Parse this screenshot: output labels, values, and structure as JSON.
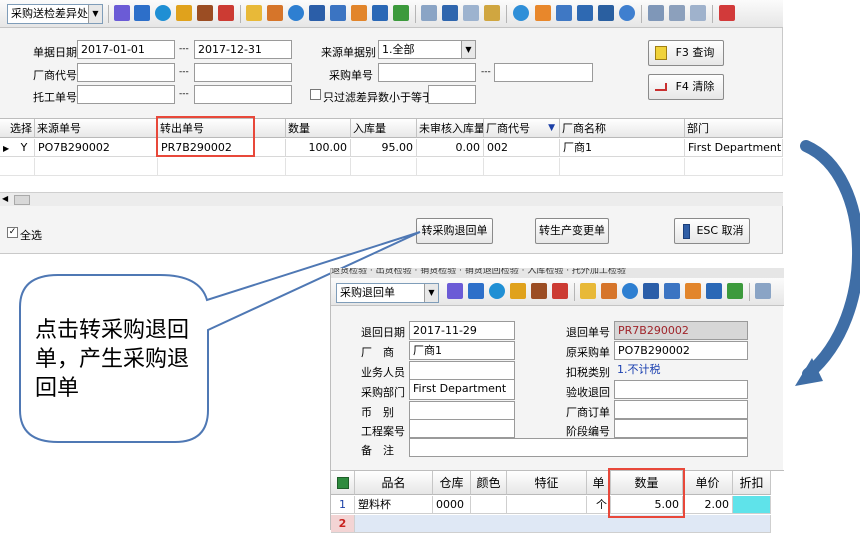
{
  "main_window": {
    "module_select": "采购送检差异处",
    "filters": {
      "doc_date_label": "单据日期",
      "doc_date_from": "2017-01-01",
      "doc_date_to": "2017-12-31",
      "range_sep": "---",
      "vendor_code_label": "厂商代号",
      "outsource_no_label": "托工单号",
      "source_type_label": "来源单据别",
      "source_type_value": "1.全部",
      "purchase_no_label": "采购单号",
      "diff_only_label": "只过滤差异数小于等于"
    },
    "buttons": {
      "query": "F3 查询",
      "clear": "F4 清除"
    },
    "grid": {
      "columns": [
        "选择",
        "来源单号",
        "转出单号",
        "数量",
        "入库量",
        "未审核入库量",
        "厂商代号",
        "厂商名称",
        "部门"
      ],
      "rows": [
        [
          "Y",
          "PO7B290002",
          "PR7B290002",
          "100.00",
          "95.00",
          "0.00",
          "002",
          "厂商1",
          "First Department"
        ]
      ]
    },
    "select_all_label": "全选",
    "actions": {
      "to_purchase_return": "转采购退回单",
      "to_production_change": "转生产变更单",
      "cancel": "ESC 取消"
    }
  },
  "callout": {
    "text": "点击转采购退回单，产生采购退回单"
  },
  "return_window": {
    "tab_strip": "退货检验 · 出货检验 · 销货检验 · 销货退回检验 · 入库检验 · 托外加工检验",
    "module_select": "采购退回单",
    "fields": {
      "return_date_label": "退回日期",
      "return_date": "2017-11-29",
      "vendor_label": "厂　商",
      "vendor": "厂商1",
      "salesperson_label": "业务人员",
      "dept_label": "采购部门",
      "dept": "First Department",
      "currency_label": "币　别",
      "project_no_label": "工程案号",
      "remark_label": "备　注",
      "return_no_label": "退回单号",
      "return_no": "PR7B290002",
      "orig_purchase_label": "原采购单",
      "orig_purchase": "PO7B290002",
      "tax_type_label": "扣税类别",
      "tax_type": "1.不计税",
      "inspection_return_label": "验收退回",
      "vendor_order_label": "厂商订单",
      "stage_no_label": "阶段编号"
    },
    "grid": {
      "columns": [
        "品名",
        "仓库",
        "颜色",
        "特征",
        "单位",
        "数量",
        "单价",
        "折扣"
      ],
      "rows": [
        {
          "num": "1",
          "cells": [
            "塑料杯",
            "0000",
            "",
            "",
            "个",
            "5.00",
            "2.00",
            ""
          ]
        }
      ],
      "next_row_num": "2"
    }
  },
  "colors": {
    "highlight_box": "#e8483a",
    "callout_border": "#4f78b4",
    "arrow": "#3f6ea6"
  }
}
